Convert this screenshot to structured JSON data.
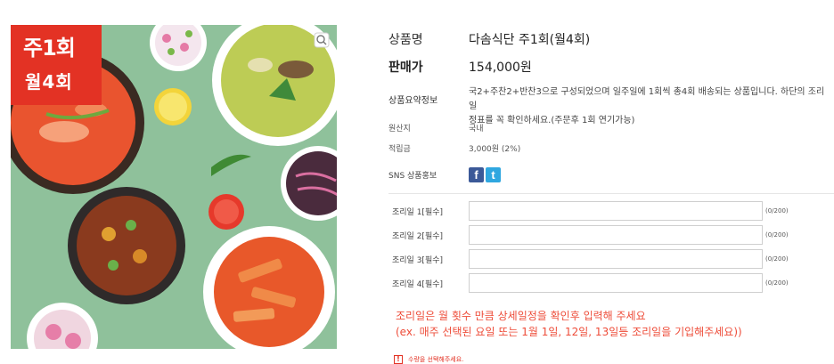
{
  "product_image": {
    "badge_line1": "주1회",
    "badge_line2": "월4회",
    "zoom_icon": "magnify-icon",
    "background_color": "#8fc19b",
    "badge_color": "#e33224"
  },
  "product": {
    "name_label": "상품명",
    "name_value": "다솜식단 주1회(월4회)",
    "price_label": "판매가",
    "price_value": "154,000원",
    "summary_label": "상품요약정보",
    "summary_line1": "국2+주찬2+반찬3으로 구성되었으며 일주일에 1회씩 총4회 배송되는 상품입니다. 하단의 조리일",
    "summary_line2": "정표를 꼭 확인하세요.(주문후 1회 연기가능)",
    "origin_label": "원산지",
    "origin_value": "국내",
    "point_label": "적립금",
    "point_value": "3,000원 (2%)",
    "sns_label": "SNS 상품홍보",
    "sns_facebook": "f",
    "sns_twitter": "t"
  },
  "options": [
    {
      "label": "조리일 1[필수]",
      "value": "",
      "counter": "(0/200)"
    },
    {
      "label": "조리일 2[필수]",
      "value": "",
      "counter": "(0/200)"
    },
    {
      "label": "조리일 3[필수]",
      "value": "",
      "counter": "(0/200)"
    },
    {
      "label": "조리일 4[필수]",
      "value": "",
      "counter": "(0/200)"
    }
  ],
  "notice": {
    "line1": "조리일은 월 횟수 만큼 상세일정을 확인후 입력해 주세요",
    "line2": "(ex. 매주 선택된 요일 또는 1월 1일, 12일, 13일등 조리일을 기입해주세요))",
    "color": "#ee4d3a"
  },
  "warning": {
    "icon": "exclamation-icon",
    "mark": "!",
    "text": "수량을 선택해주세요."
  }
}
